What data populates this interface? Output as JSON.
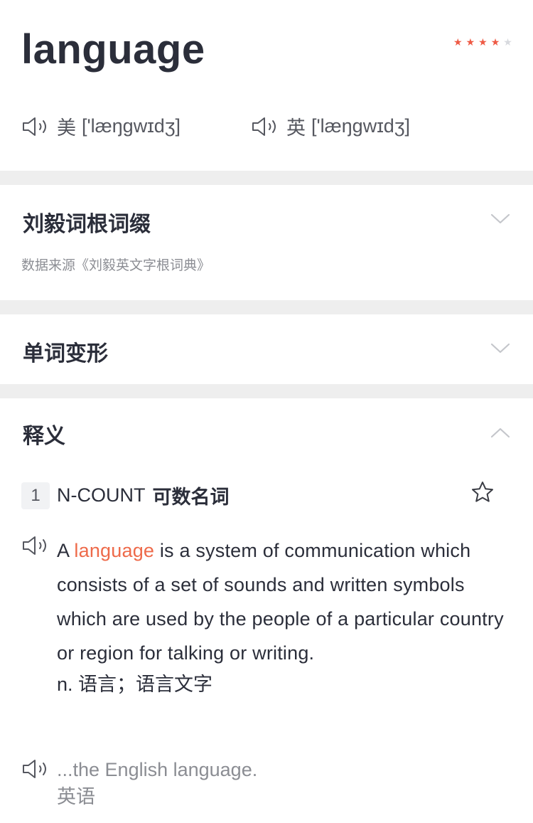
{
  "entry": {
    "word": "language",
    "rating": 4,
    "rating_max": 5,
    "star_color": "#ee5a45",
    "star_empty_color": "#d7d9de",
    "pronunciations": [
      {
        "region": "美",
        "ipa": "['læŋgwɪdʒ]"
      },
      {
        "region": "英",
        "ipa": "['læŋgwɪdʒ]"
      }
    ]
  },
  "sections": {
    "roots": {
      "title": "刘毅词根词缀",
      "source": "数据来源《刘毅英文字根词典》",
      "expanded": false
    },
    "forms": {
      "title": "单词变形",
      "expanded": false
    },
    "definitions": {
      "title": "释义",
      "expanded": true,
      "senses": [
        {
          "number": "1",
          "pos": "N-COUNT",
          "pos_zh": "可数名词",
          "def_pre": "A ",
          "def_word": "language",
          "def_post": " is a system of communication which consists of a set of sounds and written symbols which are used by the people of a particular country or region for talking or writing.",
          "def_zh": "n. 语言；语言文字",
          "example_en": "...the English language.",
          "example_zh": "英语"
        }
      ]
    }
  },
  "colors": {
    "highlight": "#ee6a4a",
    "divider": "#eeeeee"
  }
}
